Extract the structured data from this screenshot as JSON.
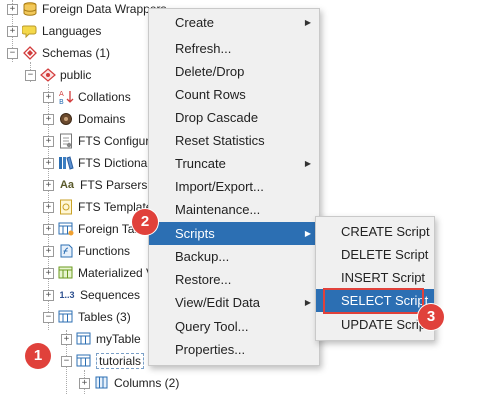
{
  "tree": {
    "nodes": [
      {
        "label": "Foreign Data Wrappers",
        "icon": "database-icon"
      },
      {
        "label": "Languages",
        "icon": "language-icon"
      },
      {
        "label": "Schemas (1)",
        "icon": "schema-icon"
      },
      {
        "label": "public",
        "icon": "schema-public-icon"
      },
      {
        "label": "Collations",
        "icon": "collation-icon"
      },
      {
        "label": "Domains",
        "icon": "domain-icon"
      },
      {
        "label": "FTS Configurations",
        "icon": "fts-configuration-icon"
      },
      {
        "label": "FTS Dictionaries",
        "icon": "fts-dictionary-icon"
      },
      {
        "label": "FTS Parsers",
        "icon": "fts-parser-icon",
        "icon_text": "Aa"
      },
      {
        "label": "FTS Templates",
        "icon": "fts-template-icon"
      },
      {
        "label": "Foreign Tables",
        "icon": "foreign-table-icon"
      },
      {
        "label": "Functions",
        "icon": "function-icon"
      },
      {
        "label": "Materialized Views",
        "icon": "materialized-view-icon"
      },
      {
        "label": "Sequences",
        "icon": "sequence-icon",
        "icon_text": "1..3"
      },
      {
        "label": "Tables (3)",
        "icon": "table-icon"
      },
      {
        "label": "myTable",
        "icon": "table-icon"
      },
      {
        "label": "tutorials",
        "icon": "table-icon"
      },
      {
        "label": "Columns (2)",
        "icon": "columns-icon"
      }
    ],
    "collapse_symbol": "−",
    "expand_symbol": "+"
  },
  "context_menu": {
    "items": [
      {
        "label": "Create",
        "submenu": true
      },
      {
        "label": "Refresh...",
        "submenu": false
      },
      {
        "label": "Delete/Drop",
        "submenu": false
      },
      {
        "label": "Count Rows",
        "submenu": false
      },
      {
        "label": "Drop Cascade",
        "submenu": false
      },
      {
        "label": "Reset Statistics",
        "submenu": false
      },
      {
        "label": "Truncate",
        "submenu": true
      },
      {
        "label": "Import/Export...",
        "submenu": false
      },
      {
        "label": "Maintenance...",
        "submenu": false
      },
      {
        "label": "Scripts",
        "submenu": true,
        "active": true
      },
      {
        "label": "Backup...",
        "submenu": false
      },
      {
        "label": "Restore...",
        "submenu": false
      },
      {
        "label": "View/Edit Data",
        "submenu": true
      },
      {
        "label": "Query Tool...",
        "submenu": false
      },
      {
        "label": "Properties...",
        "submenu": false
      }
    ],
    "submenu_arrow": "▶"
  },
  "scripts_submenu": {
    "items": [
      {
        "label": "CREATE Script"
      },
      {
        "label": "DELETE Script"
      },
      {
        "label": "INSERT Script"
      },
      {
        "label": "SELECT Script",
        "active": true
      },
      {
        "label": "UPDATE Script"
      }
    ]
  },
  "annotations": {
    "step1": "1",
    "step2": "2",
    "step3": "3",
    "color": "#e0413b"
  },
  "colors": {
    "menu_active": "#2c6fb3",
    "menu_bg": "#f0f0f0"
  }
}
